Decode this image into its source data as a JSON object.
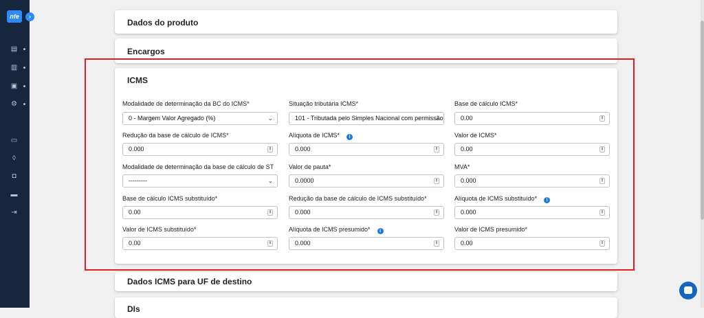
{
  "app": {
    "logo_text": "nfe"
  },
  "sections": {
    "dados_produto": "Dados do produto",
    "encargos": "Encargos",
    "icms": "ICMS",
    "dados_icms_uf": "Dados ICMS para UF de destino",
    "dis": "DIs"
  },
  "fields": [
    {
      "label": "Modalidade de determinação da BC do ICMS*",
      "value": "0 - Margem Valor Agregado (%)",
      "kind": "select"
    },
    {
      "label": "Situação tributária ICMS*",
      "value": "101 - Tributada pelo Simples Nacional com permissão",
      "kind": "select"
    },
    {
      "label": "Base de cálculo ICMS*",
      "value": "0.00",
      "kind": "number"
    },
    {
      "label": "Redução da base de cálculo de ICMS*",
      "value": "0.000",
      "kind": "number"
    },
    {
      "label": "Alíquota de ICMS*",
      "value": "0.000",
      "kind": "number",
      "info": true
    },
    {
      "label": "Valor de ICMS*",
      "value": "0.00",
      "kind": "number"
    },
    {
      "label": "Modalidade de determinação da base de cálculo de ST",
      "value": "---------",
      "kind": "select"
    },
    {
      "label": "Valor de pauta*",
      "value": "0.0000",
      "kind": "number"
    },
    {
      "label": "MVA*",
      "value": "0.000",
      "kind": "number"
    },
    {
      "label": "Base de cálculo ICMS substituído*",
      "value": "0.00",
      "kind": "number"
    },
    {
      "label": "Redução da base de cálculo de ICMS substituído*",
      "value": "0.000",
      "kind": "number"
    },
    {
      "label": "Alíquota de ICMS substituído*",
      "value": "0.000",
      "kind": "number",
      "info": true
    },
    {
      "label": "Valor de ICMS substituído*",
      "value": "0.00",
      "kind": "number"
    },
    {
      "label": "Alíquota de ICMS presumido*",
      "value": "0.000",
      "kind": "number",
      "info": true
    },
    {
      "label": "Valor de ICMS presumido*",
      "value": "0.00",
      "kind": "number"
    }
  ],
  "colors": {
    "sidebar": "#16263f",
    "accent": "#2c8cf4",
    "highlight": "#e02020",
    "info": "#1f7ae0"
  }
}
